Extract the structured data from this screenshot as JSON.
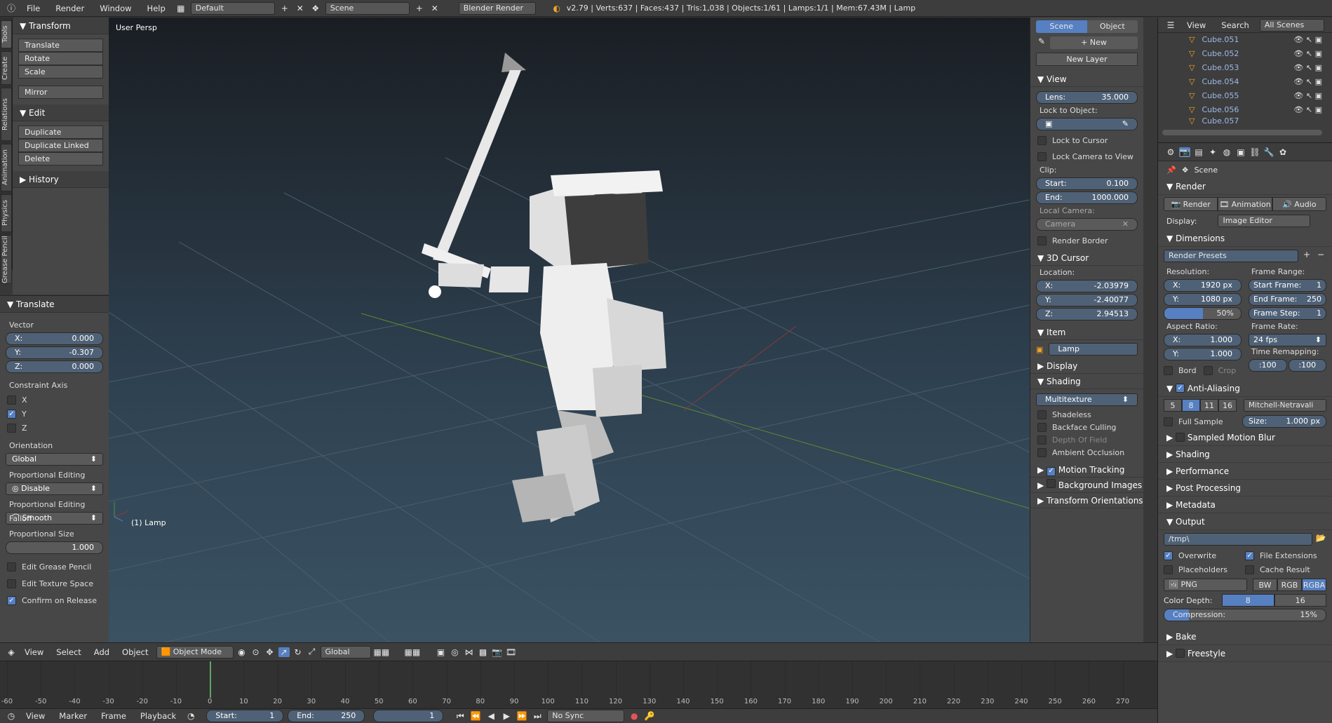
{
  "topbar": {
    "menus": [
      "File",
      "Render",
      "Window",
      "Help"
    ],
    "layout": "Default",
    "scene": "Scene",
    "engine": "Blender Render",
    "stats": "v2.79 | Verts:637 | Faces:437 | Tris:1,038 | Objects:1/61 | Lamps:1/1 | Mem:67.43M | Lamp"
  },
  "shelf_tabs": [
    "Tools",
    "Create",
    "Relations",
    "Animation",
    "Physics",
    "Grease Pencil"
  ],
  "tools": {
    "transform_header": "Transform",
    "transform_buttons": [
      "Translate",
      "Rotate",
      "Scale"
    ],
    "mirror": "Mirror",
    "edit_header": "Edit",
    "edit_buttons": [
      "Duplicate",
      "Duplicate Linked",
      "Delete"
    ],
    "history_header": "History"
  },
  "redo": {
    "header": "Translate",
    "vector_label": "Vector",
    "x": {
      "label": "X:",
      "value": "0.000"
    },
    "y": {
      "label": "Y:",
      "value": "-0.307"
    },
    "z": {
      "label": "Z:",
      "value": "0.000"
    },
    "constraint_label": "Constraint Axis",
    "axes": [
      {
        "label": "X",
        "on": false
      },
      {
        "label": "Y",
        "on": true
      },
      {
        "label": "Z",
        "on": false
      }
    ],
    "orientation_label": "Orientation",
    "orientation": "Global",
    "prop_edit_label": "Proportional Editing",
    "prop_edit": "Disable",
    "falloff_label": "Proportional Editing Falloff",
    "falloff": "Smooth",
    "prop_size_label": "Proportional Size",
    "prop_size": "1.000",
    "checks": [
      {
        "label": "Edit Grease Pencil",
        "on": false
      },
      {
        "label": "Edit Texture Space",
        "on": false
      },
      {
        "label": "Confirm on Release",
        "on": true
      }
    ]
  },
  "viewport": {
    "persp": "User Persp",
    "object": "(1) Lamp"
  },
  "npanel": {
    "tabs": [
      "Scene",
      "Object"
    ],
    "new": "New",
    "new_layer": "New Layer",
    "view_header": "View",
    "lens": {
      "label": "Lens:",
      "value": "35.000"
    },
    "lock_label": "Lock to Object:",
    "lock_cursor": "Lock to Cursor",
    "lock_camera": "Lock Camera to View",
    "clip_label": "Clip:",
    "clip_start": {
      "label": "Start:",
      "value": "0.100"
    },
    "clip_end": {
      "label": "End:",
      "value": "1000.000"
    },
    "local_camera_label": "Local Camera:",
    "camera": "Camera",
    "render_border": "Render Border",
    "cursor_header": "3D Cursor",
    "location_label": "Location:",
    "cx": {
      "label": "X:",
      "value": "-2.03979"
    },
    "cy": {
      "label": "Y:",
      "value": "-2.40077"
    },
    "cz": {
      "label": "Z:",
      "value": "2.94513"
    },
    "item_header": "Item",
    "item_name": "Lamp",
    "display_header": "Display",
    "shading_header": "Shading",
    "shading_mode": "Multitexture",
    "shading_checks": [
      "Shadeless",
      "Backface Culling",
      "Depth Of Field",
      "Ambient Occlusion"
    ],
    "motion_tracking": "Motion Tracking",
    "background_images": "Background Images",
    "transform_orient": "Transform Orientations"
  },
  "outliner": {
    "menus": [
      "View",
      "Search"
    ],
    "filter": "All Scenes",
    "rows": [
      "Cube.051",
      "Cube.052",
      "Cube.053",
      "Cube.054",
      "Cube.055",
      "Cube.056",
      "Cube.057"
    ]
  },
  "props": {
    "context": "Scene",
    "render_header": "Render",
    "render_btn": "Render",
    "anim_btn": "Animation",
    "audio_btn": "Audio",
    "display_label": "Display:",
    "display_value": "Image Editor",
    "dimensions_header": "Dimensions",
    "presets": "Render Presets",
    "resolution_label": "Resolution:",
    "res_x": {
      "label": "X:",
      "value": "1920 px"
    },
    "res_y": {
      "label": "Y:",
      "value": "1080 px"
    },
    "res_pct": "50%",
    "res_pct_fill": 0.5,
    "frame_range_label": "Frame Range:",
    "start_frame": {
      "label": "Start Frame:",
      "value": "1"
    },
    "end_frame": {
      "label": "End Frame:",
      "value": "250"
    },
    "frame_step": {
      "label": "Frame Step:",
      "value": "1"
    },
    "aspect_label": "Aspect Ratio:",
    "asp_x": {
      "label": "X:",
      "value": "1.000"
    },
    "asp_y": {
      "label": "Y:",
      "value": "1.000"
    },
    "frame_rate_label": "Frame Rate:",
    "frame_rate": "24 fps",
    "time_remap_label": "Time Remapping:",
    "remap_old": ":100",
    "remap_new": ":100",
    "bord": "Bord",
    "crop": "Crop",
    "aa_header": "Anti-Aliasing",
    "aa_samples": [
      "5",
      "8",
      "11",
      "16"
    ],
    "aa_filter": "Mitchell-Netravali",
    "full_sample": "Full Sample",
    "aa_size": {
      "label": "Size:",
      "value": "1.000 px"
    },
    "collapsed1": [
      "Sampled Motion Blur",
      "Shading",
      "Performance",
      "Post Processing",
      "Metadata"
    ],
    "output_header": "Output",
    "output_path": "/tmp\\",
    "overwrite": "Overwrite",
    "file_ext": "File Extensions",
    "placeholders": "Placeholders",
    "cache_result": "Cache Result",
    "format": "PNG",
    "color_modes": [
      "BW",
      "RGB",
      "RGBA"
    ],
    "color_depth_label": "Color Depth:",
    "depths": [
      "8",
      "16"
    ],
    "compression": {
      "label": "Compression:",
      "value": "15%",
      "fill": 0.15
    },
    "bake": "Bake",
    "freestyle": "Freestyle"
  },
  "header3d": {
    "menus": [
      "View",
      "Select",
      "Add",
      "Object"
    ],
    "mode": "Object Mode",
    "orientation": "Global"
  },
  "timeline": {
    "ticks": [
      "-60",
      "-50",
      "-40",
      "-30",
      "-20",
      "-10",
      "0",
      "10",
      "20",
      "30",
      "40",
      "50",
      "60",
      "70",
      "80",
      "90",
      "100",
      "110",
      "120",
      "130",
      "140",
      "150",
      "160",
      "170",
      "180",
      "190",
      "200",
      "210",
      "220",
      "230",
      "240",
      "250",
      "260",
      "270"
    ],
    "current_frame": 0
  },
  "timeline_header": {
    "menus": [
      "View",
      "Marker",
      "Frame",
      "Playback"
    ],
    "start": {
      "label": "Start:",
      "value": "1"
    },
    "end": {
      "label": "End:",
      "value": "250"
    },
    "current": "1",
    "sync": "No Sync"
  }
}
